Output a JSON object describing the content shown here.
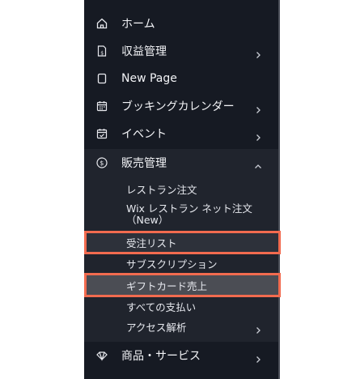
{
  "sidebar": {
    "items": [
      {
        "label": "ホーム",
        "icon": "home-icon"
      },
      {
        "label": "収益管理",
        "icon": "revenue-icon"
      },
      {
        "label": "New Page",
        "icon": "page-icon"
      },
      {
        "label": "ブッキングカレンダー",
        "icon": "calendar-icon"
      },
      {
        "label": "イベント",
        "icon": "event-calendar-icon"
      },
      {
        "label": "販売管理",
        "icon": "dollar-circle-icon"
      }
    ],
    "sales_sub": [
      {
        "label": "レストラン注文"
      },
      {
        "label": "Wix レストラン ネット注文（New）"
      },
      {
        "label": "受注リスト"
      },
      {
        "label": "サブスクリプション"
      },
      {
        "label": "ギフトカード売上"
      },
      {
        "label": "すべての支払い"
      },
      {
        "label": "アクセス解析"
      }
    ],
    "bottom_item": {
      "label": "商品・サービス",
      "icon": "products-icon"
    }
  },
  "colors": {
    "sidebar_bg": "#161a23",
    "section_bg": "#20242d",
    "highlight_border": "#f26b4f"
  }
}
